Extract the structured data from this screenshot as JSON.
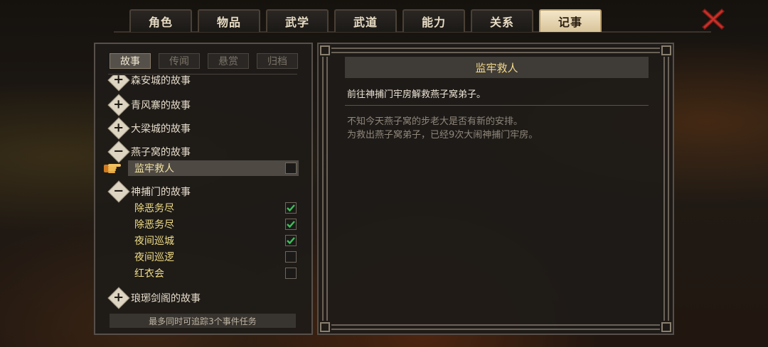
{
  "main_tabs": [
    {
      "label": "角色",
      "active": false
    },
    {
      "label": "物品",
      "active": false
    },
    {
      "label": "武学",
      "active": false
    },
    {
      "label": "武道",
      "active": false
    },
    {
      "label": "能力",
      "active": false
    },
    {
      "label": "关系",
      "active": false
    },
    {
      "label": "记事",
      "active": true
    }
  ],
  "sub_tabs": [
    {
      "label": "故事",
      "active": true
    },
    {
      "label": "传闻",
      "active": false
    },
    {
      "label": "悬赏",
      "active": false
    },
    {
      "label": "归档",
      "active": false
    }
  ],
  "story_tree": {
    "partial_group": "森安城的故事",
    "groups": [
      {
        "label": "青风寨的故事",
        "expanded": false
      },
      {
        "label": "大梁城的故事",
        "expanded": false
      },
      {
        "label": "燕子窝的故事",
        "expanded": true
      },
      {
        "label": "神捕门的故事",
        "expanded": true
      },
      {
        "label": "琅琊剑阁的故事",
        "expanded": false
      }
    ],
    "quests": [
      {
        "label": "监牢救人",
        "checked": false,
        "selected": true
      },
      {
        "label": "除恶务尽",
        "checked": true,
        "selected": false
      },
      {
        "label": "除恶务尽",
        "checked": true,
        "selected": false
      },
      {
        "label": "夜间巡城",
        "checked": true,
        "selected": false
      },
      {
        "label": "夜间巡逻",
        "checked": false,
        "selected": false
      },
      {
        "label": "红衣会",
        "checked": false,
        "selected": false
      }
    ]
  },
  "footer_note": "最多同时可追踪3个事件任务",
  "detail": {
    "title": "监牢救人",
    "objective": "前往神捕门牢房解救燕子窝弟子。",
    "desc_line1": "不知今天燕子窝的步老大是否有新的安排。",
    "desc_line2": "为救出燕子窝弟子，已经9次大闹神捕门牢房。"
  },
  "colors": {
    "accent_gold": "#f3d98a",
    "check_green": "#3fbf5a",
    "close_red": "#c8302a"
  }
}
